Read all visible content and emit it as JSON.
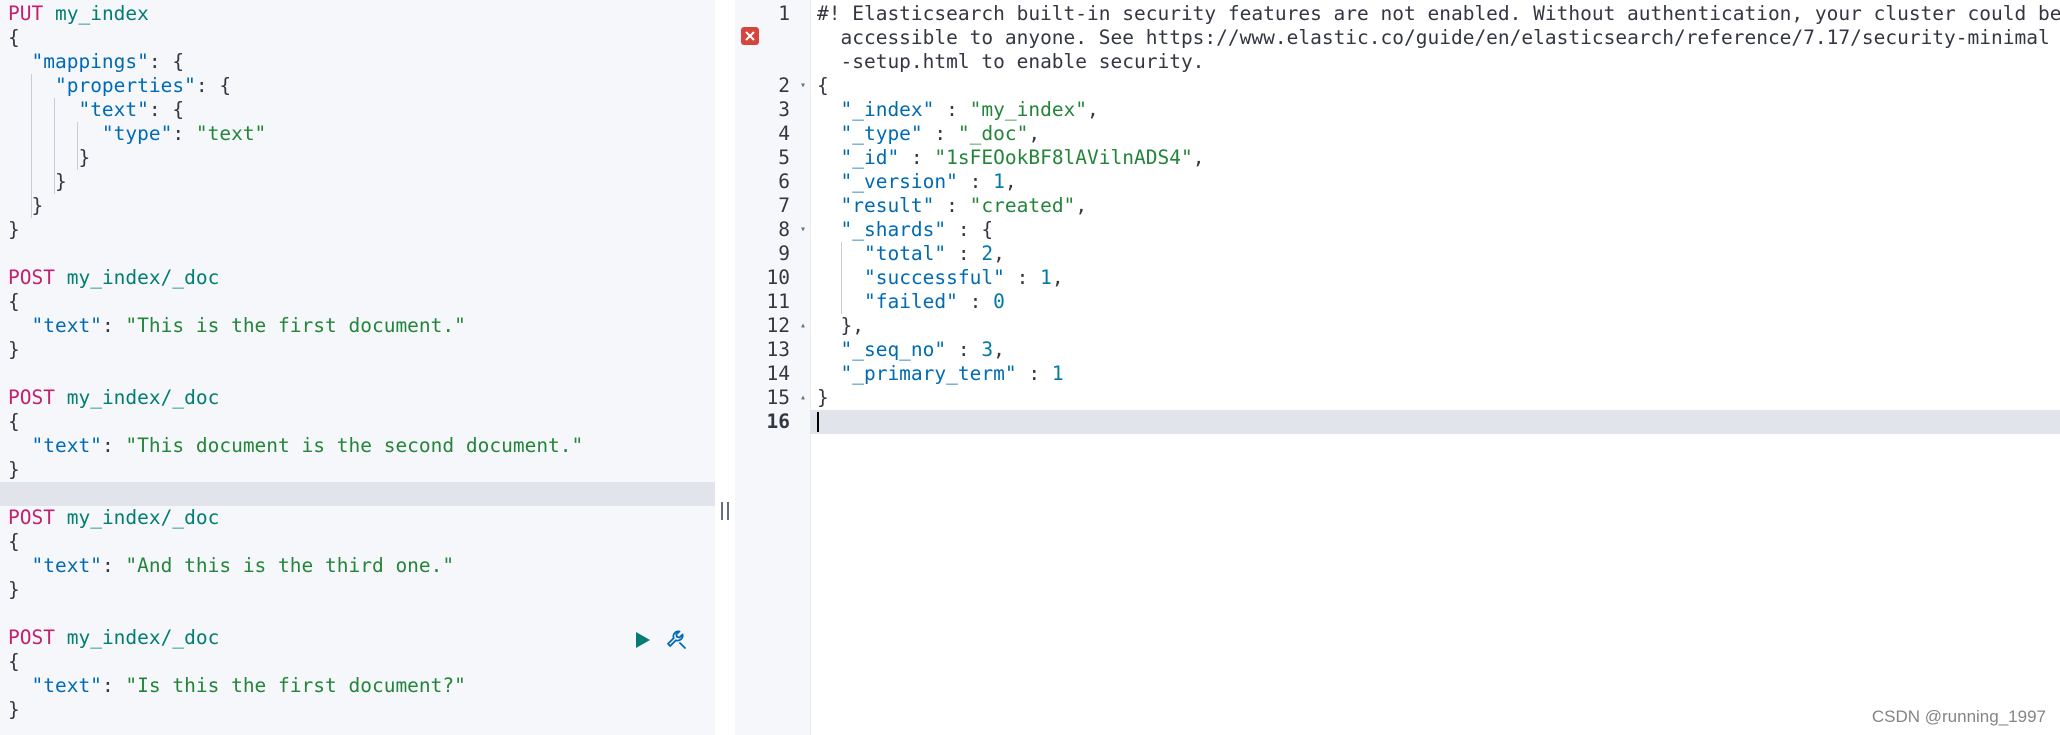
{
  "request_editor": {
    "blocks": [
      {
        "method": "PUT",
        "url": "my_index"
      },
      {
        "method": "POST",
        "url": "my_index/_doc",
        "text": "\"This is the first document.\""
      },
      {
        "method": "POST",
        "url": "my_index/_doc",
        "text": "\"This document is the second document.\""
      },
      {
        "method": "POST",
        "url": "my_index/_doc",
        "text": "\"And this is the third one.\""
      },
      {
        "method": "POST",
        "url": "my_index/_doc",
        "text": "\"Is this the first document?\""
      }
    ],
    "keys": {
      "mappings": "\"mappings\"",
      "properties": "\"properties\"",
      "text": "\"text\"",
      "type": "\"type\""
    },
    "type_value": "\"text\"",
    "action_icons": [
      "play-icon",
      "wrench-icon"
    ]
  },
  "response_viewer": {
    "line_numbers": [
      "1",
      "2",
      "3",
      "4",
      "5",
      "6",
      "7",
      "8",
      "9",
      "10",
      "11",
      "12",
      "13",
      "14",
      "15",
      "16"
    ],
    "warning": {
      "line1": "#! Elasticsearch built-in security features are not enabled. Without authentication, your cluster could be",
      "line2": "accessible to anyone. See https://www.elastic.co/guide/en/elasticsearch/reference/7.17/security-minimal",
      "line3": "-setup.html to enable security."
    },
    "fields": {
      "index_key": "\"_index\"",
      "index_val": "\"my_index\"",
      "type_key": "\"_type\"",
      "type_val": "\"_doc\"",
      "id_key": "\"_id\"",
      "id_val": "\"1sFEOokBF8lAVilnADS4\"",
      "version_key": "\"_version\"",
      "version_val": "1",
      "result_key": "\"result\"",
      "result_val": "\"created\"",
      "shards_key": "\"_shards\"",
      "total_key": "\"total\"",
      "total_val": "2",
      "successful_key": "\"successful\"",
      "successful_val": "1",
      "failed_key": "\"failed\"",
      "failed_val": "0",
      "seq_no_key": "\"_seq_no\"",
      "seq_no_val": "3",
      "primary_term_key": "\"_primary_term\"",
      "primary_term_val": "1"
    }
  },
  "watermark": "CSDN @running_1997",
  "colors": {
    "method": "#c61e6f",
    "url": "#017d73",
    "key": "#006bb4",
    "string": "#24853a",
    "number": "#0079a5",
    "error": "#d6453d"
  }
}
